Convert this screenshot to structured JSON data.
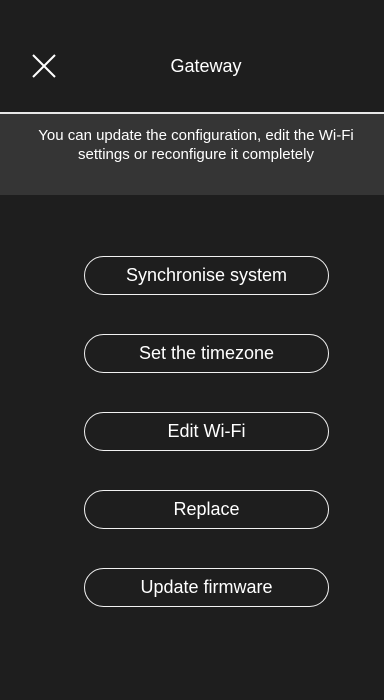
{
  "header": {
    "close_icon": "close-icon",
    "title": "Gateway"
  },
  "banner": {
    "text": "You can update the configuration, edit the Wi-Fi settings or reconfigure it completely"
  },
  "menu": {
    "items": [
      {
        "label": "Synchronise system"
      },
      {
        "label": "Set the timezone"
      },
      {
        "label": "Edit Wi-Fi"
      },
      {
        "label": "Replace"
      },
      {
        "label": "Update firmware"
      }
    ]
  },
  "colors": {
    "background": "#1e1e1e",
    "banner": "#353535",
    "text": "#ffffff",
    "outline": "#f2f2f2"
  }
}
